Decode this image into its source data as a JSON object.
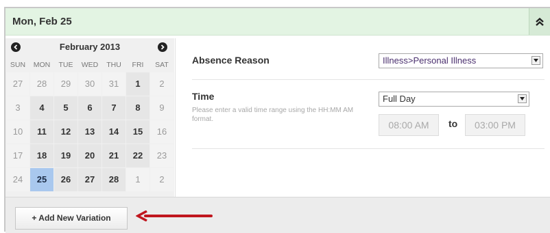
{
  "header": {
    "title": "Mon, Feb 25",
    "collapse_icon": "double-chevron-up-icon"
  },
  "calendar": {
    "month_label": "February 2013",
    "prev_icon": "chevron-left-icon",
    "next_icon": "chevron-right-icon",
    "weekdays": [
      "SUN",
      "MON",
      "TUE",
      "WED",
      "THU",
      "FRI",
      "SAT"
    ],
    "weeks": [
      [
        "27",
        "28",
        "29",
        "30",
        "31",
        "1",
        "2"
      ],
      [
        "3",
        "4",
        "5",
        "6",
        "7",
        "8",
        "9"
      ],
      [
        "10",
        "11",
        "12",
        "13",
        "14",
        "15",
        "16"
      ],
      [
        "17",
        "18",
        "19",
        "20",
        "21",
        "22",
        "23"
      ],
      [
        "24",
        "25",
        "26",
        "27",
        "28",
        "1",
        "2"
      ]
    ],
    "selected_day": "25"
  },
  "form": {
    "absence_reason": {
      "label": "Absence Reason",
      "value": "Illness>Personal Illness"
    },
    "time": {
      "label": "Time",
      "hint": "Please enter a valid time range using the HH:MM AM format.",
      "value": "Full Day",
      "start": "08:00 AM",
      "to_label": "to",
      "end": "03:00 PM"
    }
  },
  "footer": {
    "add_button_label": "+ Add New Variation",
    "arrow_color": "#c0161e"
  },
  "colors": {
    "header_bg": "#e3f4e3",
    "selected_day": "#a9c8ee"
  }
}
